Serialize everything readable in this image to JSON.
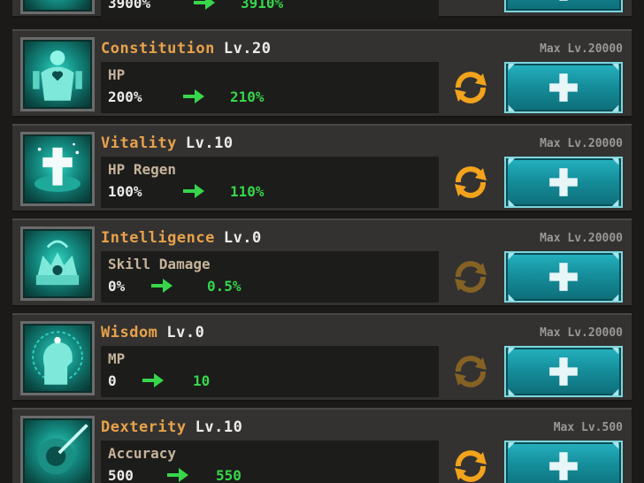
{
  "top_partial": {
    "from": "3900%",
    "to": "3910%"
  },
  "stats": [
    {
      "id": "constitution",
      "name": "Constitution",
      "level": "Lv.20",
      "max_level": "Max Lv.20000",
      "effect": "HP",
      "from": "200%",
      "to": "210%",
      "icon": "heart-body-icon",
      "reset_enabled": true
    },
    {
      "id": "vitality",
      "name": "Vitality",
      "level": "Lv.10",
      "max_level": "Max Lv.20000",
      "effect": "HP Regen",
      "from": "100%",
      "to": "110%",
      "icon": "holy-cross-icon",
      "reset_enabled": true
    },
    {
      "id": "intelligence",
      "name": "Intelligence",
      "level": "Lv.0",
      "max_level": "Max Lv.20000",
      "effect": "Skill Damage",
      "from": "0%",
      "to": "0.5%",
      "icon": "crowned-brain-icon",
      "reset_enabled": false
    },
    {
      "id": "wisdom",
      "name": "Wisdom",
      "level": "Lv.0",
      "max_level": "Max Lv.20000",
      "effect": "MP",
      "from": "0",
      "to": "10",
      "icon": "glowing-head-icon",
      "reset_enabled": false
    },
    {
      "id": "dexterity",
      "name": "Dexterity",
      "level": "Lv.10",
      "max_level": "Max Lv.500",
      "effect": "Accuracy",
      "from": "500",
      "to": "550",
      "icon": "target-arrow-icon",
      "reset_enabled": true
    }
  ],
  "colors": {
    "stat_name": "#e8a24a",
    "increase_value": "#37d64b",
    "button_teal": "#168f9c",
    "reset_orange": "#f2a31c"
  }
}
